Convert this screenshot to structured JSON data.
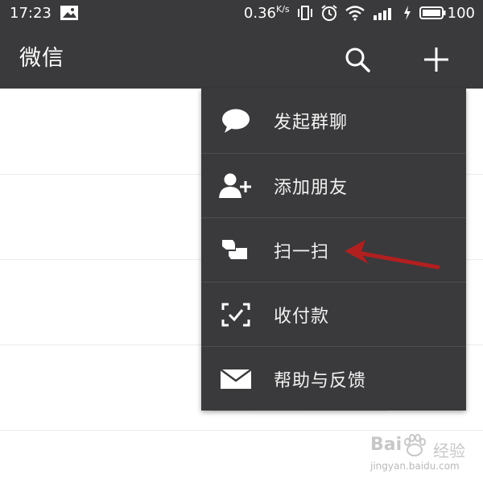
{
  "status_bar": {
    "time": "17:23",
    "net_speed": "0.36",
    "net_speed_unit": "K/s",
    "battery": "100",
    "icons": [
      "picture-notification-icon",
      "vibrate-icon",
      "alarm-icon",
      "wifi-icon",
      "signal-icon",
      "charging-icon",
      "battery-icon"
    ]
  },
  "title_bar": {
    "title": "微信",
    "icons": [
      "search-icon",
      "plus-icon"
    ]
  },
  "menu": {
    "items": [
      {
        "label": "发起群聊",
        "icon": "chat-bubble-icon"
      },
      {
        "label": "添加朋友",
        "icon": "add-friend-icon"
      },
      {
        "label": "扫一扫",
        "icon": "scan-icon"
      },
      {
        "label": "收付款",
        "icon": "payment-icon"
      },
      {
        "label": "帮助与反馈",
        "icon": "mail-icon"
      }
    ]
  },
  "annotation": {
    "arrow_color": "#b21f1f",
    "points_to": "扫一扫"
  },
  "watermark": {
    "brand": "Bai",
    "brand_suffix": "经验",
    "url": "jingyan.baidu.com"
  },
  "colors": {
    "bar_bg": "#3a3a3c",
    "menu_bg": "#3a3a3c",
    "text": "#ffffff"
  }
}
